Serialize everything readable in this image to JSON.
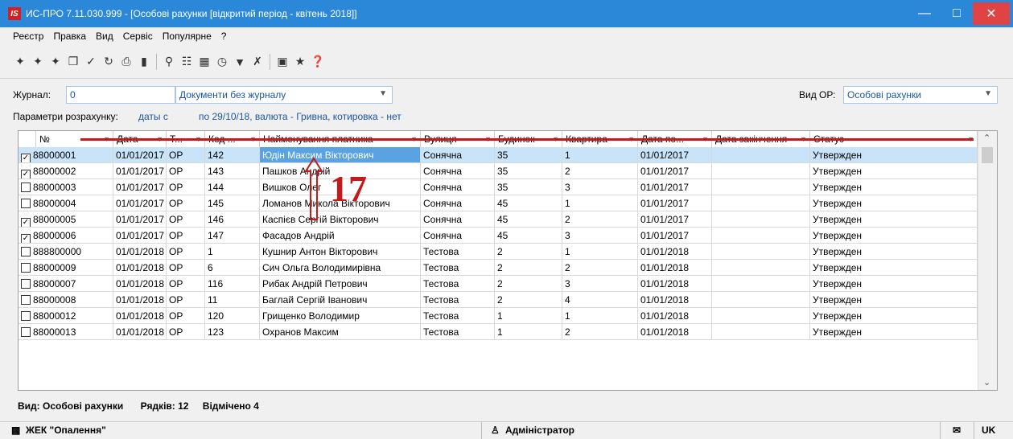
{
  "window": {
    "title": "ИС-ПРО 7.11.030.999 - [Особові рахунки [відкритий період - квітень 2018]]",
    "logo_text": "IS"
  },
  "menu": [
    "Реєстр",
    "Правка",
    "Вид",
    "Сервіс",
    "Популярне",
    "?"
  ],
  "toolbar": {
    "icons": [
      "new-icon",
      "new-copy-icon",
      "new-sub-icon",
      "copy-icon",
      "filter-icon",
      "refresh-icon",
      "print-icon",
      "preview-icon",
      "find-icon",
      "tree-icon",
      "grid-icon",
      "clock-icon",
      "funnel-icon",
      "clear-filter-icon",
      "calc-icon",
      "favorite-icon",
      "help-icon"
    ]
  },
  "filters": {
    "journal_label": "Журнал:",
    "journal_value": "0",
    "journal_name": "Документи без журналу",
    "vid_label": "Вид ОР:",
    "vid_value": "Особові рахунки",
    "params_label": "Параметри розрахунку:",
    "params_value_prefix": "даты с",
    "params_value": "по 29/10/18, валюта - Гривна, котировка - нет"
  },
  "columns": [
    "№",
    "Дата",
    "Т...",
    "Код ...",
    "Найменування платника",
    "Вулиця",
    "Будинок",
    "Квартира",
    "Дата по...",
    "Дата закінчення",
    "Статус"
  ],
  "rows": [
    {
      "checked": true,
      "num": "88000001",
      "date": "01/01/2017",
      "type": "ОР",
      "code": "142",
      "name": "Юдін Максим Вікторович",
      "street": "Сонячна",
      "house": "35",
      "apt": "1",
      "date_from": "01/01/2017",
      "date_end": "",
      "status": "Утвержден",
      "selected": true
    },
    {
      "checked": true,
      "num": "88000002",
      "date": "01/01/2017",
      "type": "ОР",
      "code": "143",
      "name": "Пашков Андрій",
      "street": "Сонячна",
      "house": "35",
      "apt": "2",
      "date_from": "01/01/2017",
      "date_end": "",
      "status": "Утвержден"
    },
    {
      "checked": false,
      "num": "88000003",
      "date": "01/01/2017",
      "type": "ОР",
      "code": "144",
      "name": "Вишков Олег",
      "street": "Сонячна",
      "house": "35",
      "apt": "3",
      "date_from": "01/01/2017",
      "date_end": "",
      "status": "Утвержден"
    },
    {
      "checked": false,
      "num": "88000004",
      "date": "01/01/2017",
      "type": "ОР",
      "code": "145",
      "name": "Ломанов Микола Вікторович",
      "street": "Сонячна",
      "house": "45",
      "apt": "1",
      "date_from": "01/01/2017",
      "date_end": "",
      "status": "Утвержден"
    },
    {
      "checked": true,
      "num": "88000005",
      "date": "01/01/2017",
      "type": "ОР",
      "code": "146",
      "name": "Каспієв Сергій Вікторович",
      "street": "Сонячна",
      "house": "45",
      "apt": "2",
      "date_from": "01/01/2017",
      "date_end": "",
      "status": "Утвержден"
    },
    {
      "checked": true,
      "num": "88000006",
      "date": "01/01/2017",
      "type": "ОР",
      "code": "147",
      "name": "Фасадов Андрій",
      "street": "Сонячна",
      "house": "45",
      "apt": "3",
      "date_from": "01/01/2017",
      "date_end": "",
      "status": "Утвержден"
    },
    {
      "checked": false,
      "num": "888800000",
      "date": "01/01/2018",
      "type": "ОР",
      "code": "1",
      "name": "Кушнир Антон Вікторович",
      "street": "Тестова",
      "house": "2",
      "apt": "1",
      "date_from": "01/01/2018",
      "date_end": "",
      "status": "Утвержден"
    },
    {
      "checked": false,
      "num": "88000009",
      "date": "01/01/2018",
      "type": "ОР",
      "code": "6",
      "name": "Сич Ольга Володимирівна",
      "street": "Тестова",
      "house": "2",
      "apt": "2",
      "date_from": "01/01/2018",
      "date_end": "",
      "status": "Утвержден"
    },
    {
      "checked": false,
      "num": "88000007",
      "date": "01/01/2018",
      "type": "ОР",
      "code": "116",
      "name": "Рибак Андрій Петрович",
      "street": "Тестова",
      "house": "2",
      "apt": "3",
      "date_from": "01/01/2018",
      "date_end": "",
      "status": "Утвержден"
    },
    {
      "checked": false,
      "num": "88000008",
      "date": "01/01/2018",
      "type": "ОР",
      "code": "11",
      "name": "Баглай Сергій Іванович",
      "street": "Тестова",
      "house": "2",
      "apt": "4",
      "date_from": "01/01/2018",
      "date_end": "",
      "status": "Утвержден"
    },
    {
      "checked": false,
      "num": "88000012",
      "date": "01/01/2018",
      "type": "ОР",
      "code": "120",
      "name": "Грищенко Володимир",
      "street": "Тестова",
      "house": "1",
      "apt": "1",
      "date_from": "01/01/2018",
      "date_end": "",
      "status": "Утвержден"
    },
    {
      "checked": false,
      "num": "88000013",
      "date": "01/01/2018",
      "type": "ОР",
      "code": "123",
      "name": "Охранов Максим",
      "street": "Тестова",
      "house": "1",
      "apt": "2",
      "date_from": "01/01/2018",
      "date_end": "",
      "status": "Утвержден"
    }
  ],
  "grid_status": {
    "view": "Вид: Особові рахунки",
    "rows": "Рядків: 12",
    "marked": "Відмічено 4"
  },
  "annotation": {
    "number": "17",
    "color": "#c41a1a"
  },
  "statusbar": {
    "org": "ЖЕК \"Опалення\"",
    "user": "Адміністратор",
    "lang": "UK"
  }
}
